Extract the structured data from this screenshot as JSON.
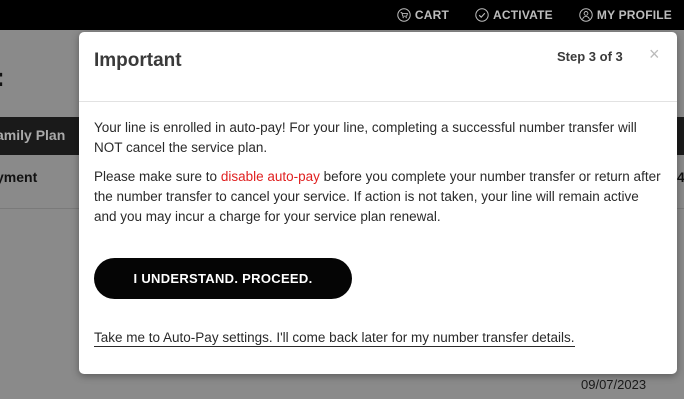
{
  "topnav": {
    "items": [
      {
        "label": "CART",
        "icon": "cart-icon"
      },
      {
        "label": "ACTIVATE",
        "icon": "check-circle-icon"
      },
      {
        "label": "MY PROFILE",
        "icon": "user-icon"
      }
    ]
  },
  "background": {
    "title_fragment": ":",
    "plan_label": "amily Plan",
    "payment_label": "yment",
    "right_fragment": "4",
    "date": "09/07/2023"
  },
  "modal": {
    "title": "Important",
    "step": "Step 3 of 3",
    "close": "×",
    "paragraph1": "Your line is enrolled in auto-pay! For your line, completing a successful number transfer will NOT cancel the service plan.",
    "paragraph2_before": "Please make sure to ",
    "paragraph2_link": "disable auto-pay",
    "paragraph2_after": " before you complete your number transfer or return after the number transfer to cancel your service. If action is not taken, your line will remain active and you may incur a charge for your service plan renewal.",
    "proceed_button": "I UNDERSTAND. PROCEED.",
    "autopay_link": "Take me to Auto-Pay settings. I'll come back later for my number transfer details."
  },
  "colors": {
    "link_red": "#e02020",
    "button_bg": "#050505",
    "overlay": "#8a8a8a"
  }
}
